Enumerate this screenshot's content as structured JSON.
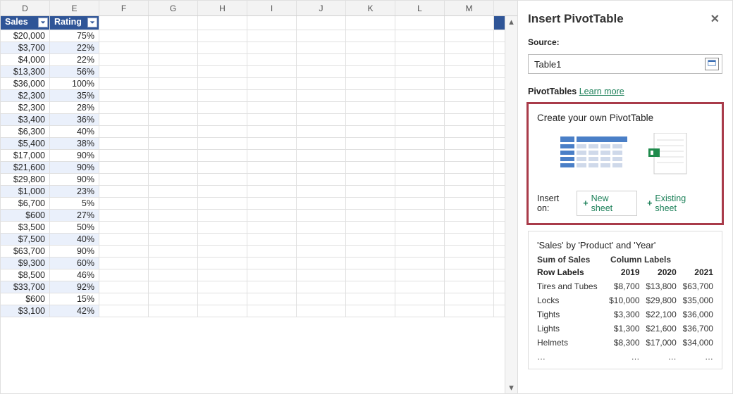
{
  "sheet": {
    "columns": [
      "D",
      "E",
      "F",
      "G",
      "H",
      "I",
      "J",
      "K",
      "L",
      "M"
    ],
    "headers": {
      "sales": "Sales",
      "rating": "Rating"
    },
    "rows": [
      {
        "sales": "$20,000",
        "rating": "75%"
      },
      {
        "sales": "$3,700",
        "rating": "22%"
      },
      {
        "sales": "$4,000",
        "rating": "22%"
      },
      {
        "sales": "$13,300",
        "rating": "56%"
      },
      {
        "sales": "$36,000",
        "rating": "100%"
      },
      {
        "sales": "$2,300",
        "rating": "35%"
      },
      {
        "sales": "$2,300",
        "rating": "28%"
      },
      {
        "sales": "$3,400",
        "rating": "36%"
      },
      {
        "sales": "$6,300",
        "rating": "40%"
      },
      {
        "sales": "$5,400",
        "rating": "38%"
      },
      {
        "sales": "$17,000",
        "rating": "90%"
      },
      {
        "sales": "$21,600",
        "rating": "90%"
      },
      {
        "sales": "$29,800",
        "rating": "90%"
      },
      {
        "sales": "$1,000",
        "rating": "23%"
      },
      {
        "sales": "$6,700",
        "rating": "5%"
      },
      {
        "sales": "$600",
        "rating": "27%"
      },
      {
        "sales": "$3,500",
        "rating": "50%"
      },
      {
        "sales": "$7,500",
        "rating": "40%"
      },
      {
        "sales": "$63,700",
        "rating": "90%"
      },
      {
        "sales": "$9,300",
        "rating": "60%"
      },
      {
        "sales": "$8,500",
        "rating": "46%"
      },
      {
        "sales": "$33,700",
        "rating": "92%"
      },
      {
        "sales": "$600",
        "rating": "15%"
      },
      {
        "sales": "$3,100",
        "rating": "42%"
      }
    ]
  },
  "pane": {
    "title": "Insert PivotTable",
    "source_label": "Source:",
    "source_value": "Table1",
    "pt_label": "PivotTables",
    "learn_more": "Learn more",
    "create_card": {
      "title": "Create your own PivotTable",
      "insert_on": "Insert on:",
      "new_sheet": "New sheet",
      "existing_sheet": "Existing sheet"
    },
    "preview": {
      "title": "'Sales' by 'Product' and 'Year'",
      "sum_label": "Sum of Sales",
      "col_labels": "Column Labels",
      "row_labels": "Row Labels",
      "years": [
        "2019",
        "2020",
        "2021"
      ],
      "rows": [
        {
          "label": "Tires and Tubes",
          "vals": [
            "$8,700",
            "$13,800",
            "$63,700"
          ]
        },
        {
          "label": "Locks",
          "vals": [
            "$10,000",
            "$29,800",
            "$35,000"
          ]
        },
        {
          "label": "Tights",
          "vals": [
            "$3,300",
            "$22,100",
            "$36,000"
          ]
        },
        {
          "label": "Lights",
          "vals": [
            "$1,300",
            "$21,600",
            "$36,700"
          ]
        },
        {
          "label": "Helmets",
          "vals": [
            "$8,300",
            "$17,000",
            "$34,000"
          ]
        }
      ],
      "ellipsis": "…"
    }
  }
}
